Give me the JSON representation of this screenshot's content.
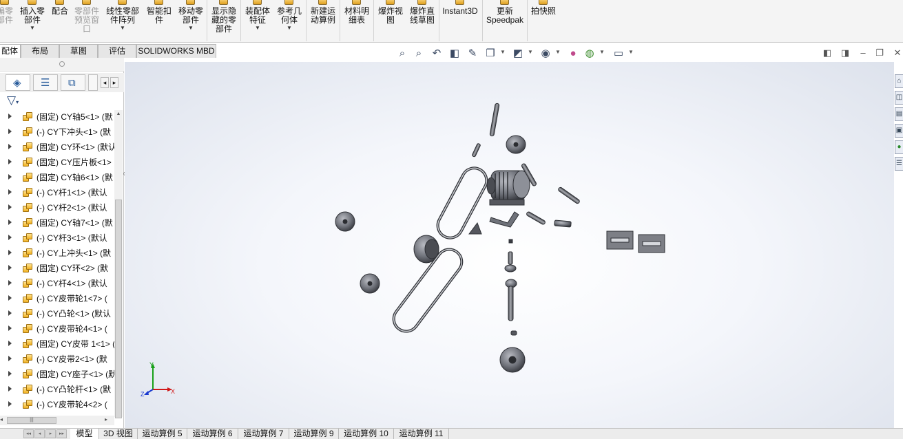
{
  "ribbon": {
    "buttons": [
      {
        "label": "插入零\n部件",
        "has_dropdown": true
      },
      {
        "label": "配合",
        "has_dropdown": false
      },
      {
        "label": "零部件\n预览窗\n口",
        "has_dropdown": false,
        "disabled": true
      },
      {
        "label": "线性零部\n件阵列",
        "has_dropdown": true
      },
      {
        "label": "智能扣\n件",
        "has_dropdown": false
      },
      {
        "label": "移动零\n部件",
        "has_dropdown": true
      },
      {
        "label": "显示隐\n藏的零\n部件",
        "has_dropdown": false
      },
      {
        "label": "装配体\n特征",
        "has_dropdown": true
      },
      {
        "label": "参考几\n何体",
        "has_dropdown": true
      },
      {
        "label": "新建运\n动算例",
        "has_dropdown": false
      },
      {
        "label": "材料明\n细表",
        "has_dropdown": false
      },
      {
        "label": "爆炸视\n图",
        "has_dropdown": false
      },
      {
        "label": "爆炸直\n线草图",
        "has_dropdown": false
      },
      {
        "label": "Instant3D",
        "has_dropdown": false
      },
      {
        "label": "更新\nSpeedpak",
        "has_dropdown": false
      },
      {
        "label": "拍快照",
        "has_dropdown": false
      }
    ],
    "partial_left_label": "编零\n部件"
  },
  "command_tabs": [
    "配体",
    "布局",
    "草图",
    "评估",
    "SOLIDWORKS MBD"
  ],
  "heads_up_icons": [
    "zoom-to-fit-icon",
    "zoom-to-area-icon",
    "previous-view-icon",
    "section-view-icon",
    "dynamic-annotation-icon",
    "view-orientation-icon",
    "display-style-icon",
    "hide-show-items-icon",
    "edit-appearance-icon",
    "apply-scene-icon",
    "view-settings-icon"
  ],
  "feature_tree": {
    "items": [
      {
        "state": "(固定)",
        "name": "CY轴5<1>",
        "suffix": "(默"
      },
      {
        "state": "(-)",
        "name": "CY下冲头<1>",
        "suffix": "(默"
      },
      {
        "state": "(固定)",
        "name": "CY环<1>",
        "suffix": "(默认"
      },
      {
        "state": "(固定)",
        "name": "CY压片板<1>",
        "suffix": ""
      },
      {
        "state": "(固定)",
        "name": "CY轴6<1>",
        "suffix": "(默"
      },
      {
        "state": "(-)",
        "name": "CY杆1<1>",
        "suffix": "(默认"
      },
      {
        "state": "(-)",
        "name": "CY杆2<1>",
        "suffix": "(默认"
      },
      {
        "state": "(固定)",
        "name": "CY轴7<1>",
        "suffix": "(默"
      },
      {
        "state": "(-)",
        "name": "CY杆3<1>",
        "suffix": "(默认"
      },
      {
        "state": "(-)",
        "name": "CY上冲头<1>",
        "suffix": "(默"
      },
      {
        "state": "(固定)",
        "name": "CY环<2>",
        "suffix": "(默"
      },
      {
        "state": "(-)",
        "name": "CY杆4<1>",
        "suffix": "(默认"
      },
      {
        "state": "(-)",
        "name": "CY皮带轮1<7>",
        "suffix": "("
      },
      {
        "state": "(-)",
        "name": "CY凸轮<1>",
        "suffix": "(默认"
      },
      {
        "state": "(-)",
        "name": "CY皮带轮4<1>",
        "suffix": "("
      },
      {
        "state": "(固定)",
        "name": "CY皮带 1<1>",
        "suffix": "("
      },
      {
        "state": "(-)",
        "name": "CY皮带2<1>",
        "suffix": "(默"
      },
      {
        "state": "(固定)",
        "name": "CY座子<1>",
        "suffix": "(默"
      },
      {
        "state": "(-)",
        "name": "CY凸轮杆<1>",
        "suffix": "(默"
      },
      {
        "state": "(-)",
        "name": "CY皮带轮4<2>",
        "suffix": "("
      }
    ]
  },
  "triad": {
    "x": "X",
    "y": "Y",
    "z": "Z"
  },
  "bottom_tabs": [
    {
      "label": "模型",
      "active": true
    },
    {
      "label": "3D 视图",
      "active": false
    },
    {
      "label": "运动算例 5",
      "active": false
    },
    {
      "label": "运动算例 6",
      "active": false
    },
    {
      "label": "运动算例 7",
      "active": false
    },
    {
      "label": "运动算例 9",
      "active": false
    },
    {
      "label": "运动算例 10",
      "active": false
    },
    {
      "label": "运动算例 11",
      "active": false
    }
  ],
  "colors": {
    "ribbon_bg": "#f4f4f4",
    "model_gray": "#7d7f86",
    "model_dark": "#3a3c42",
    "triad_x": "#d01818",
    "triad_y": "#18a018",
    "triad_z": "#1a3ad0"
  }
}
